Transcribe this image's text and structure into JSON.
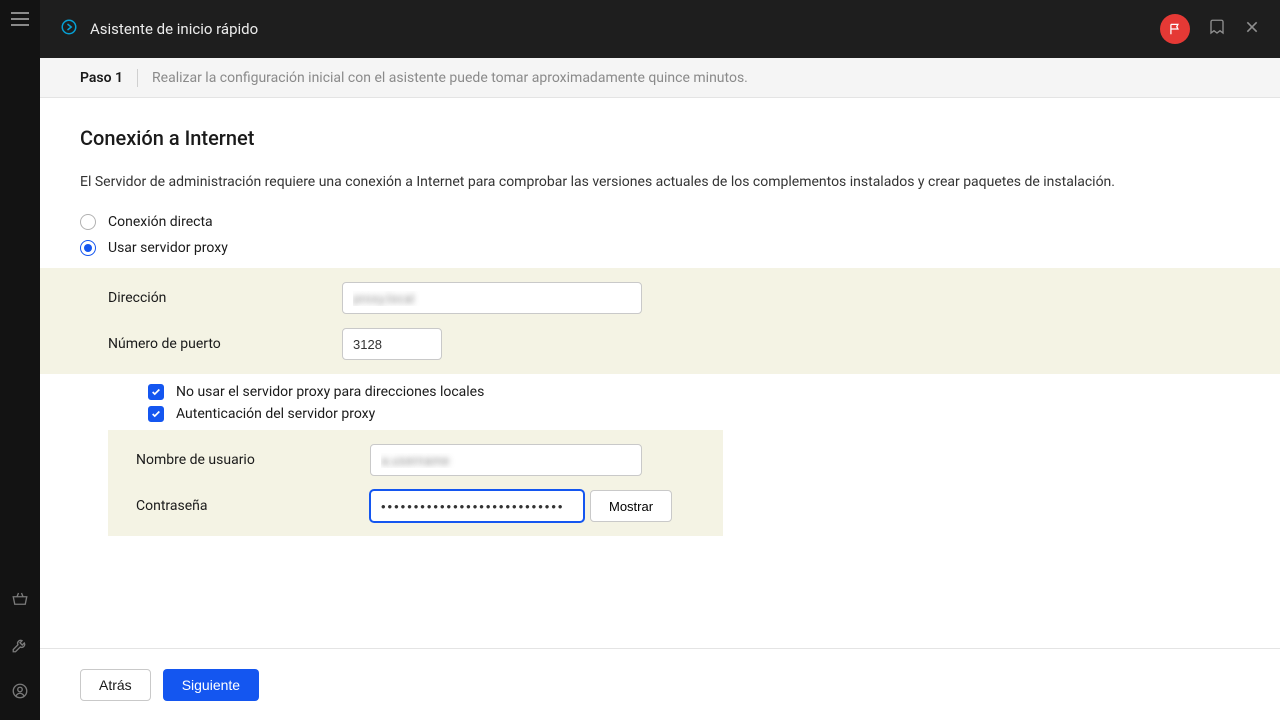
{
  "header": {
    "title": "Asistente de inicio rápido"
  },
  "stepbar": {
    "step_label": "Paso 1",
    "description": "Realizar la configuración inicial con el asistente puede tomar aproximadamente quince minutos."
  },
  "section": {
    "title": "Conexión a Internet",
    "description": "El Servidor de administración requiere una conexión a Internet para comprobar las versiones actuales de los complementos instalados y crear paquetes de instalación."
  },
  "connection": {
    "direct_label": "Conexión directa",
    "proxy_label": "Usar servidor proxy",
    "selected": "proxy"
  },
  "proxy": {
    "address_label": "Dirección",
    "address_value": "proxy.local",
    "port_label": "Número de puerto",
    "port_value": "3128"
  },
  "options": {
    "bypass_local_label": "No usar el servidor proxy para direcciones locales",
    "bypass_local_checked": true,
    "auth_label": "Autenticación del servidor proxy",
    "auth_checked": true
  },
  "auth": {
    "user_label": "Nombre de usuario",
    "user_value": "a.username",
    "password_label": "Contraseña",
    "password_value": "............................",
    "show_label": "Mostrar"
  },
  "footer": {
    "back_label": "Atrás",
    "next_label": "Siguiente"
  }
}
